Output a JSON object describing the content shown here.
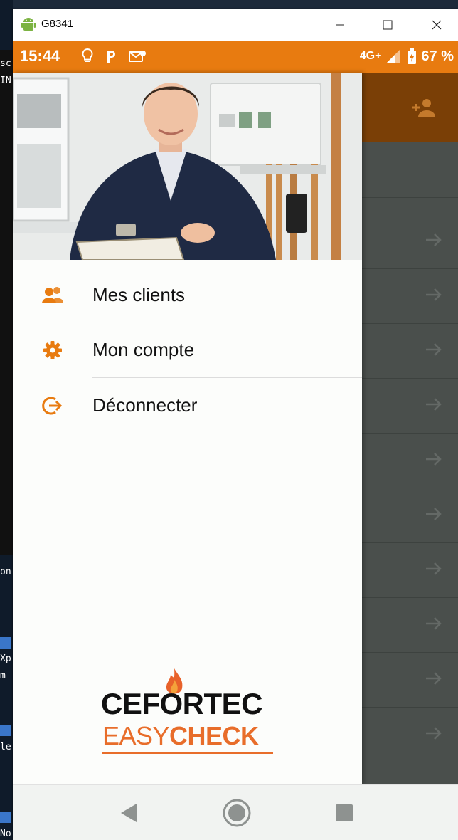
{
  "window": {
    "title": "G8341"
  },
  "status": {
    "time": "15:44",
    "network": "4G+",
    "battery": "67 %"
  },
  "desktop": {
    "fragments": [
      "sc",
      "IN",
      "on",
      "Xp",
      "m",
      "le",
      "No"
    ]
  },
  "drawer": {
    "menu": [
      {
        "label": "Mes clients",
        "icon": "users-icon"
      },
      {
        "label": "Mon compte",
        "icon": "gear-icon"
      },
      {
        "label": "Déconnecter",
        "icon": "logout-icon"
      }
    ],
    "logo": {
      "top": "CEFORTEC",
      "bottom_light": "EASY",
      "bottom_bold": "CHECK"
    }
  },
  "colors": {
    "accent": "#e87b10",
    "header_dark": "#7a3f06",
    "scrim": "#4a4f4c"
  }
}
